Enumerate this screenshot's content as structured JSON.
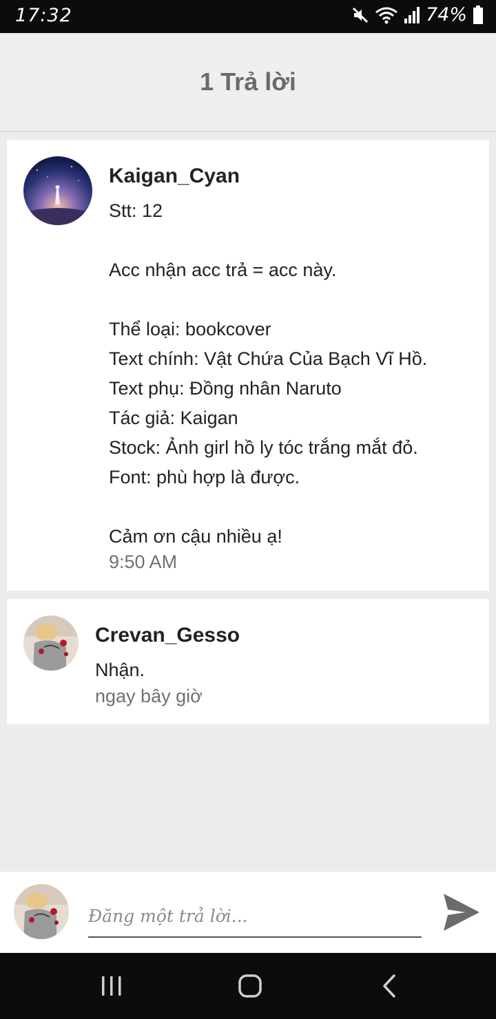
{
  "status_bar": {
    "time": "17:32",
    "battery_text": "74%",
    "icons": [
      "mute-icon",
      "wifi-icon",
      "signal-icon",
      "battery-icon"
    ]
  },
  "header": {
    "title": "1 Trả lời"
  },
  "comments": [
    {
      "username": "Kaigan_Cyan",
      "lines": [
        "Stt: 12",
        "",
        "Acc nhận acc trả = acc này.",
        "",
        "Thể loại: bookcover",
        "Text chính: Vật Chứa Của Bạch Vĩ Hồ.",
        "Text phụ: Đồng nhân Naruto",
        "Tác giả: Kaigan",
        "Stock: Ảnh girl hồ ly tóc trắng mắt đỏ.",
        "Font: phù hợp là được.",
        "",
        "Cảm ơn cậu nhiều ạ!"
      ],
      "time": "9:50 AM"
    },
    {
      "username": "Crevan_Gesso",
      "lines": [
        "Nhận."
      ],
      "time": "ngay bây giờ"
    }
  ],
  "reply": {
    "placeholder": "Đăng một trả lời...",
    "value": ""
  },
  "colors": {
    "background": "#ececec",
    "header_bg": "#efefef",
    "header_text": "#6a6a6a",
    "card_bg": "#ffffff",
    "timestamp": "#707070",
    "send_icon": "#6b6b6b"
  },
  "nav": {
    "icons": [
      "recent-apps-icon",
      "home-icon",
      "back-icon"
    ]
  }
}
